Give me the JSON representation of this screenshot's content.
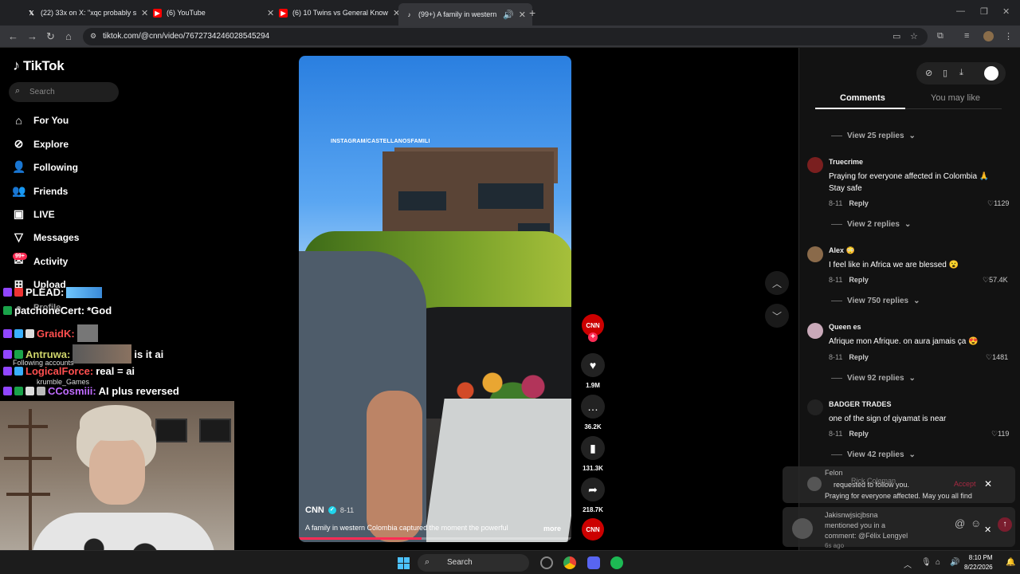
{
  "browser": {
    "tabs": [
      {
        "title": "(22) 33x on X: \"xqc probably se",
        "favicon": "X"
      },
      {
        "title": "(6) YouTube",
        "favicon": "YT"
      },
      {
        "title": "(6) 10 Twins vs General Knowle",
        "favicon": "YT"
      },
      {
        "title": "(99+) A family in western C",
        "favicon": "TT"
      }
    ],
    "url": "tiktok.com/@cnn/video/7672734246028545294"
  },
  "tiktok": {
    "logo": "TikTok",
    "search_placeholder": "Search",
    "nav": [
      {
        "label": "For You",
        "icon": "home-icon"
      },
      {
        "label": "Explore",
        "icon": "compass-icon"
      },
      {
        "label": "Following",
        "icon": "user-follow-icon"
      },
      {
        "label": "Friends",
        "icon": "friends-icon"
      },
      {
        "label": "LIVE",
        "icon": "live-icon"
      },
      {
        "label": "Messages",
        "icon": "send-icon"
      },
      {
        "label": "Activity",
        "icon": "inbox-icon"
      },
      {
        "label": "Upload",
        "icon": "upload-icon"
      },
      {
        "label": "Profile",
        "icon": "profile-icon"
      }
    ],
    "activity_badge": "99+",
    "following_accounts_label": "Following accounts",
    "following_account": "krumble_Games"
  },
  "chat_overlay": [
    {
      "name": "PLEAD:",
      "message": ""
    },
    {
      "name": "patchoneCert:",
      "message": "*God"
    },
    {
      "name": "GraidK:",
      "message": ""
    },
    {
      "name": "Antruwa:",
      "message": "is it ai"
    },
    {
      "name": "LogicalForce:",
      "message": "real = ai"
    },
    {
      "name": "CCosmiii:",
      "message": "AI plus reversed"
    }
  ],
  "video": {
    "watermark": "INSTAGRAM/CASTELLANOSFAMILI",
    "author": "CNN",
    "date": "8-11",
    "description": "A family in western Colombia captured the moment the powerful",
    "more": "more",
    "progress": 0.45,
    "channel_logo": "CNN"
  },
  "actions": {
    "likes": "1.9M",
    "comments": "36.2K",
    "saves": "131.3K",
    "shares": "218.7K"
  },
  "panel": {
    "tab_comments": "Comments",
    "tab_you_may_like": "You may like",
    "view_replies_top": "View 25 replies",
    "comments": [
      {
        "name": "Truecrime",
        "text": "Praying for everyone affected in Colombia 🙏 Stay safe",
        "date": "8-11",
        "reply": "Reply",
        "likes": "1129",
        "view_replies": "View 2 replies",
        "avatar_color": "#7a1f1f"
      },
      {
        "name": "Alex 😳",
        "text": "I feel like in Africa we are blessed 😮",
        "date": "8-11",
        "reply": "Reply",
        "likes": "57.4K",
        "view_replies": "View 750 replies",
        "avatar_color": "#8a6a4a"
      },
      {
        "name": "Queen es",
        "text": "Afrique mon Afrique. on aura jamais ça 😍",
        "date": "8-11",
        "reply": "Reply",
        "likes": "1481",
        "view_replies": "View 92 replies",
        "avatar_color": "#c9a9b9"
      },
      {
        "name": "BADGER TRADES",
        "text": "one of the sign of qiyamat is near",
        "date": "8-11",
        "reply": "Reply",
        "likes": "119",
        "view_replies": "View 42 replies",
        "avatar_color": "#222222"
      }
    ],
    "notification1": {
      "line1": "Felon",
      "line1b": "Rick Coleman",
      "line2": "requested to follow you.",
      "line3": "Praying for everyone affected. May you all find",
      "accept": "Accept"
    },
    "notification2": {
      "name": "Jakisnwjsicjbsna",
      "line2": "mentioned you in a",
      "line3": "comment: @Félix Lengyel",
      "time": "6s ago"
    }
  },
  "taskbar": {
    "search_placeholder": "Search",
    "time": "8:10 PM",
    "date": "8/22/2026"
  },
  "colors": {
    "tiktok_red": "#fe2c55",
    "cnn_red": "#cc0000",
    "chat_name": "#ff4f4f",
    "windows_blue": "#4cc2ff"
  }
}
